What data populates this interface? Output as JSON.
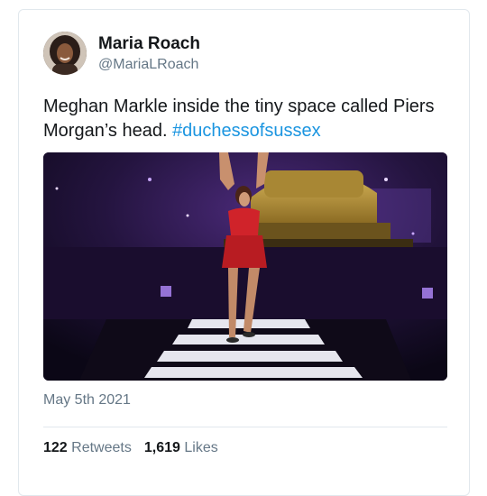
{
  "author": {
    "display_name": "Maria Roach",
    "handle": "@MariaLRoach"
  },
  "tweet": {
    "text": "Meghan Markle inside the tiny space called Piers Morgan’s head. ",
    "hashtag": "#duchessofsussex",
    "date": "May 5th 2021"
  },
  "stats": {
    "retweets_count": "122",
    "retweets_label": "Retweets",
    "likes_count": "1,619",
    "likes_label": "Likes"
  },
  "colors": {
    "hashtag": "#1b95e0",
    "secondary_text": "#657786",
    "border": "#e1e8ed"
  }
}
